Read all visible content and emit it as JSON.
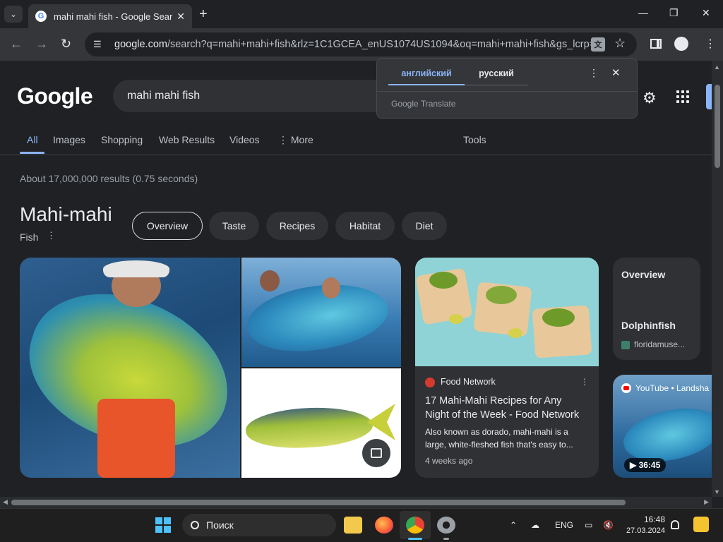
{
  "browser": {
    "tab_title": "mahi mahi fish - Google Search",
    "url_host": "google.com",
    "url_rest": "/search?q=mahi+mahi+fish&rlz=1C1GCEA_enUS1074US1094&oq=mahi+mahi+fish&gs_lcrp=E..."
  },
  "translate_popup": {
    "lang_source": "английский",
    "lang_target": "русский",
    "brand": "Google Translate"
  },
  "search": {
    "logo": "Google",
    "query": "mahi mahi fish",
    "nav": [
      "All",
      "Images",
      "Shopping",
      "Web Results",
      "Videos",
      "More"
    ],
    "tools": "Tools",
    "stats": "About 17,000,000 results (0.75 seconds)"
  },
  "knowledge_panel": {
    "title": "Mahi-mahi",
    "subtitle": "Fish",
    "chips": [
      "Overview",
      "Taste",
      "Recipes",
      "Habitat",
      "Diet"
    ]
  },
  "food_card": {
    "source": "Food Network",
    "title": "17 Mahi-Mahi Recipes for Any Night of the Week - Food Network",
    "description": "Also known as dorado, mahi-mahi is a large, white-fleshed fish that's easy to...",
    "age": "4 weeks ago"
  },
  "overview_card": {
    "title": "Overview",
    "name": "Dolphinfish",
    "source": "floridamuse..."
  },
  "video_card": {
    "source": "YouTube • Landsha",
    "duration": "36:45"
  },
  "taskbar": {
    "search_placeholder": "Поиск",
    "lang": "ENG",
    "time": "16:48",
    "date": "27.03.2024"
  },
  "colors": {
    "accent": "#8ab4f8",
    "page_bg": "#202124",
    "card_bg": "#303134"
  }
}
